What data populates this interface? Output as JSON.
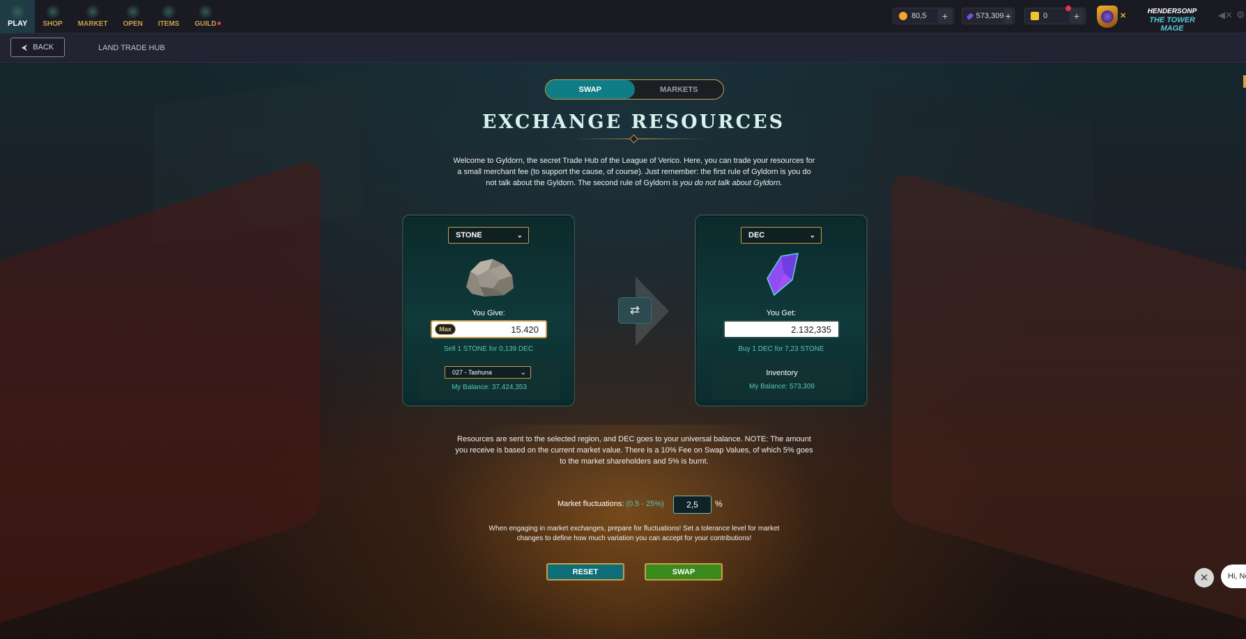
{
  "nav": {
    "items": [
      {
        "label": "PLAY",
        "icon": "play-icon",
        "active": true
      },
      {
        "label": "SHOP",
        "icon": "shop-icon"
      },
      {
        "label": "MARKET",
        "icon": "market-icon"
      },
      {
        "label": "OPEN",
        "icon": "open-icon"
      },
      {
        "label": "ITEMS",
        "icon": "items-icon"
      },
      {
        "label": "GUILD",
        "icon": "guild-icon"
      }
    ]
  },
  "currencies": {
    "credits": {
      "value": "80,5",
      "icon": "credits-coin-icon",
      "color": "#f5a623"
    },
    "dec": {
      "value": "573,309",
      "icon": "dec-crystal-icon",
      "color": "#7a4de0"
    },
    "tickets": {
      "value": "0",
      "icon": "ticket-icon",
      "color": "#f0c430"
    }
  },
  "player": {
    "name": "HENDERSONP",
    "title": "THE TOWER MAGE"
  },
  "subbar": {
    "back_label": "BACK",
    "breadcrumb": "LAND TRADE HUB"
  },
  "tabs": {
    "swap": "SWAP",
    "markets": "MARKETS"
  },
  "page": {
    "title": "EXCHANGE RESOURCES",
    "intro_main": "Welcome to Gyldorn, the secret Trade Hub of the League of Verico. Here, you can trade your resources for a small merchant fee (to support the cause, of course). Just remember: the first rule of Gyldorn is you do not talk about the Gyldorn. The second rule of Gyldorn is ",
    "intro_italic": "you do not talk about Gyldorn."
  },
  "give": {
    "resource": "STONE",
    "label": "You Give:",
    "max_label": "Max",
    "amount": "15.420",
    "rate": "Sell 1 STONE for 0,139 DEC",
    "region": "027 - Tashuna",
    "balance": "My Balance: 37.424,353"
  },
  "get": {
    "resource": "DEC",
    "label": "You Get:",
    "amount": "2.132,335",
    "rate": "Buy 1 DEC for 7,23 STONE",
    "destination": "Inventory",
    "balance": "My Balance: 573,309"
  },
  "notice": "Resources are sent to the selected region, and DEC goes to your universal balance. NOTE: The amount you receive is based on the current market value. There is a 10% Fee on Swap Values, of which 5% goes to the market shareholders and 5% is burnt.",
  "fluctuation": {
    "label": "Market fluctuations:",
    "range": "(0.5 - 25%)",
    "value": "2,5",
    "unit": "%",
    "hint": "When engaging in market exchanges, prepare for fluctuations! Set a tolerance level for market changes to define how much variation you can accept for your contributions!"
  },
  "actions": {
    "reset": "RESET",
    "swap": "SWAP"
  },
  "chat": {
    "bubble": "Hi, Ne"
  }
}
